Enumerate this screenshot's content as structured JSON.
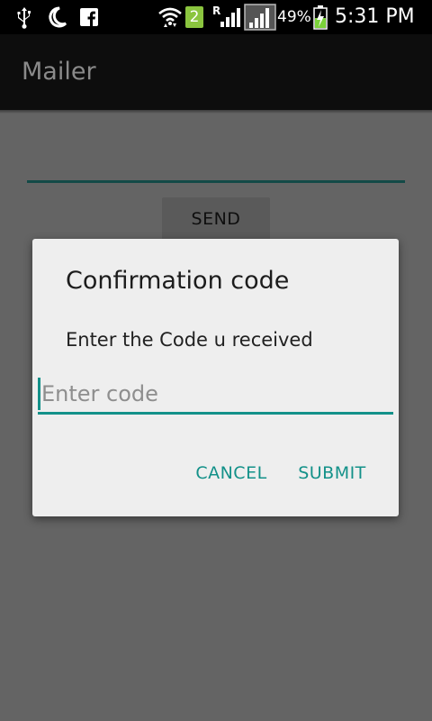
{
  "status_bar": {
    "battery_percent": "49%",
    "time": "5:31 PM",
    "sim_badge": "2",
    "roaming_indicator": "R",
    "icons": [
      "usb-icon",
      "moon-icon",
      "facebook-icon",
      "wifi-icon",
      "sim-badge-icon",
      "signal-icon",
      "signal-icon-2",
      "battery-charging-icon"
    ]
  },
  "app_bar": {
    "title": "Mailer"
  },
  "main": {
    "send_label": "SEND"
  },
  "dialog": {
    "title": "Confirmation code",
    "message": "Enter the Code u received",
    "input_placeholder": "Enter code",
    "input_value": "",
    "cancel_label": "CANCEL",
    "submit_label": "SUBMIT"
  },
  "colors": {
    "accent": "#139189",
    "scrim_background": "#646464",
    "dialog_background": "#eeeeee",
    "app_bar": "#0d0d0d",
    "status_bar": "#000000"
  }
}
